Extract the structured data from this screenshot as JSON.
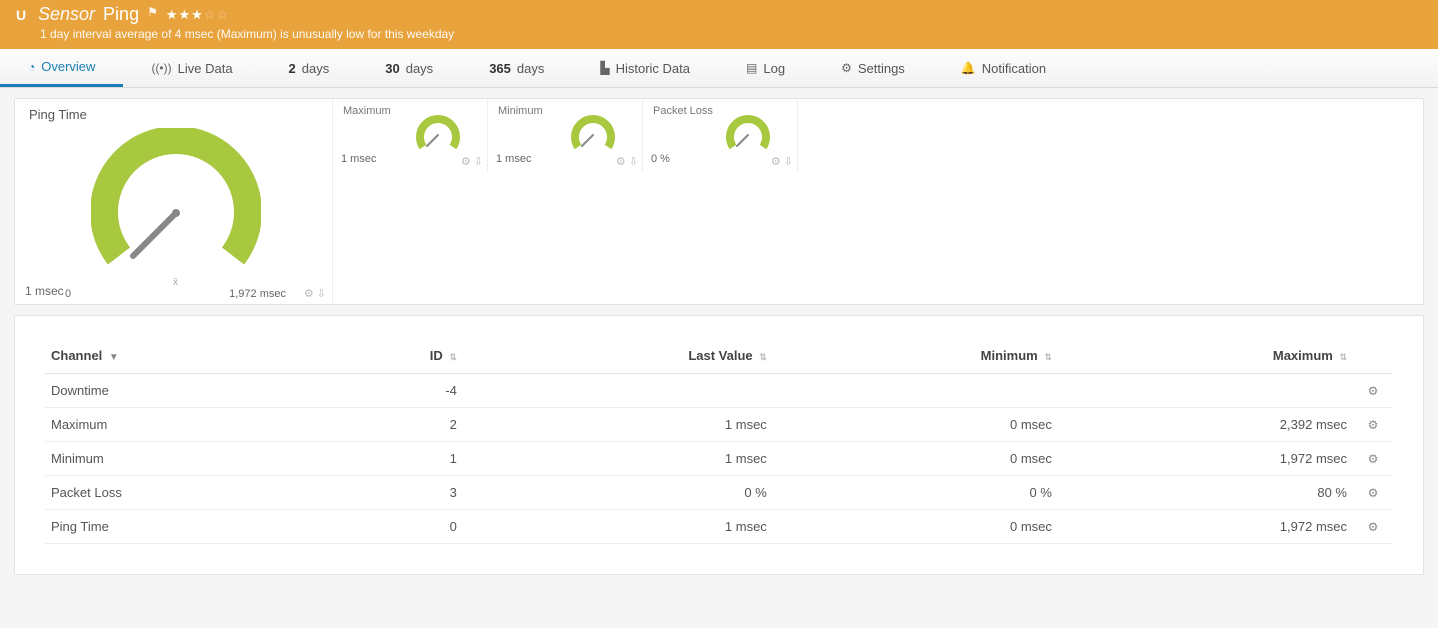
{
  "header": {
    "status_letter": "U",
    "sensor_label": "Sensor",
    "sensor_name": "Ping",
    "stars_filled": 3,
    "stars_empty": 2,
    "subtitle": "1 day interval average of 4 msec (Maximum) is unusually low for this weekday"
  },
  "tabs": {
    "overview": "Overview",
    "live": "Live Data",
    "d2_num": "2",
    "d2_unit": "days",
    "d30_num": "30",
    "d30_unit": "days",
    "d365_num": "365",
    "d365_unit": "days",
    "historic": "Historic Data",
    "log": "Log",
    "settings": "Settings",
    "notifications": "Notification"
  },
  "gauges": {
    "main": {
      "title": "Ping Time",
      "value": "1 msec",
      "scale_min": "0",
      "scale_max": "1,972 msec"
    },
    "small": [
      {
        "title": "Maximum",
        "value": "1 msec"
      },
      {
        "title": "Minimum",
        "value": "1 msec"
      },
      {
        "title": "Packet Loss",
        "value": "0 %"
      }
    ]
  },
  "table": {
    "headers": {
      "channel": "Channel",
      "id": "ID",
      "last": "Last Value",
      "min": "Minimum",
      "max": "Maximum"
    },
    "rows": [
      {
        "channel": "Downtime",
        "id": "-4",
        "last": "",
        "min": "",
        "max": ""
      },
      {
        "channel": "Maximum",
        "id": "2",
        "last": "1 msec",
        "min": "0 msec",
        "max": "2,392 msec"
      },
      {
        "channel": "Minimum",
        "id": "1",
        "last": "1 msec",
        "min": "0 msec",
        "max": "1,972 msec"
      },
      {
        "channel": "Packet Loss",
        "id": "3",
        "last": "0 %",
        "min": "0 %",
        "max": "80 %"
      },
      {
        "channel": "Ping Time",
        "id": "0",
        "last": "1 msec",
        "min": "0 msec",
        "max": "1,972 msec"
      }
    ]
  }
}
